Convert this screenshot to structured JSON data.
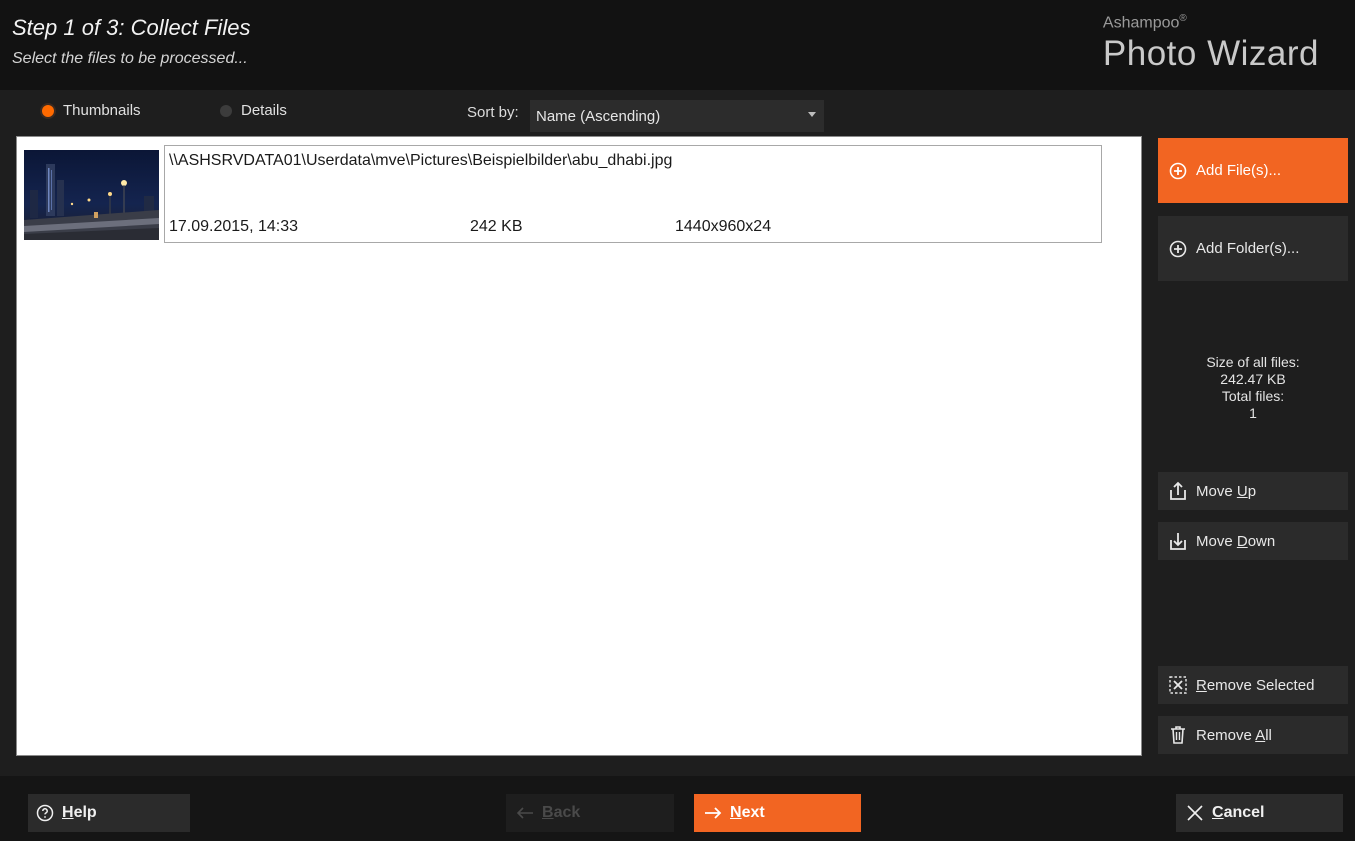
{
  "header": {
    "step_title": "Step 1 of 3: Collect Files",
    "step_subtitle": "Select the files to be processed...",
    "brand_top": "Ashampoo",
    "brand_mark": "®",
    "brand_main": "Photo Wizard"
  },
  "viewbar": {
    "thumbnails_label": "Thumbnails",
    "details_label": "Details",
    "selected_view": "Thumbnails",
    "sort_label": "Sort by:",
    "sort_value": "Name (Ascending)"
  },
  "files": [
    {
      "path": "\\\\ASHSRVDATA01\\Userdata\\mve\\Pictures\\Beispielbilder\\abu_dhabi.jpg",
      "date": "17.09.2015, 14:33",
      "size": "242 KB",
      "dimensions": "1440x960x24"
    }
  ],
  "side": {
    "add_files_label": "Add File(s)...",
    "add_folders_label": "Add Folder(s)...",
    "size_all_label": "Size of all files:",
    "size_all_value": "242.47 KB",
    "total_files_label": "Total files:",
    "total_files_value": "1",
    "move_up_prefix": "Move ",
    "move_up_underlined": "U",
    "move_up_suffix": "p",
    "move_down_prefix": "Move ",
    "move_down_underlined": "D",
    "move_down_suffix": "own",
    "remove_selected_underlined": "R",
    "remove_selected_suffix": "emove Selected",
    "remove_all_prefix": "Remove ",
    "remove_all_underlined": "A",
    "remove_all_suffix": "ll"
  },
  "footer": {
    "help_underlined": "H",
    "help_suffix": "elp",
    "back_underlined": "B",
    "back_suffix": "ack",
    "next_underlined": "N",
    "next_suffix": "ext",
    "cancel_underlined": "C",
    "cancel_suffix": "ancel"
  },
  "colors": {
    "accent": "#f26522",
    "background": "#1e1e1e",
    "list_background": "#ffffff"
  },
  "icons": {
    "add_files": "plus-circle-icon",
    "add_folders": "plus-circle-icon",
    "move_up": "move-up-icon",
    "move_down": "move-down-icon",
    "remove_selected": "remove-selected-icon",
    "remove_all": "trash-icon",
    "help": "help-icon",
    "back": "arrow-left-icon",
    "next": "arrow-right-icon",
    "cancel": "close-icon",
    "sort_dropdown": "chevron-down-icon"
  }
}
